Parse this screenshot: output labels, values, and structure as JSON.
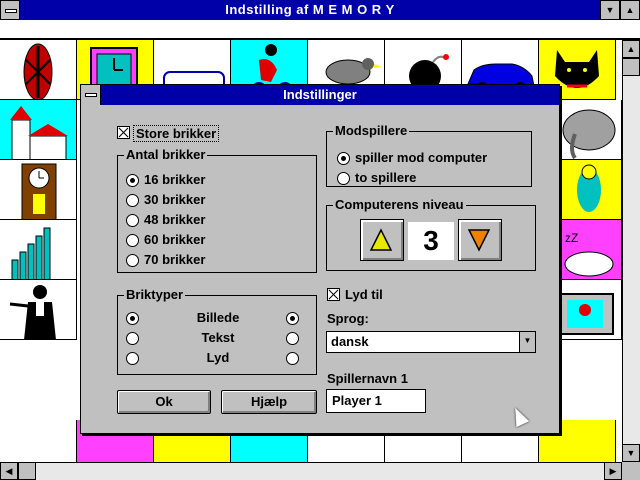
{
  "window": {
    "title": "Indstilling af M E M O R Y",
    "minimize_icon": "triangle-down",
    "maximize_icon": "triangle-up"
  },
  "dialog": {
    "title": "Indstillinger",
    "store_brikker": {
      "label": "Store brikker",
      "checked": true
    },
    "antal_brikker": {
      "label": "Antal brikker",
      "options": [
        "16 brikker",
        "30 brikker",
        "48 brikker",
        "60 brikker",
        "70 brikker"
      ],
      "selected_index": 0
    },
    "briktyper": {
      "label": "Briktyper",
      "rows": [
        "Billede",
        "Tekst",
        "Lyd"
      ],
      "left_selected_index": 0,
      "right_selected_index": 0
    },
    "ok_label": "Ok",
    "help_label": "Hjælp",
    "modspillere": {
      "label": "Modspillere",
      "options": [
        "spiller mod computer",
        "to spillere"
      ],
      "selected_index": 0
    },
    "computerens_niveau": {
      "label": "Computerens niveau",
      "value": "3",
      "up_icon": "triangle-up",
      "down_icon": "triangle-down"
    },
    "lyd_til": {
      "label": "Lyd til",
      "checked": true
    },
    "sprog": {
      "label": "Sprog:",
      "value": "dansk"
    },
    "spillernavn": {
      "label": "Spillernavn 1",
      "value": "Player 1"
    }
  },
  "board": {
    "icons": [
      "masai-shield",
      "clock",
      "car",
      "cyclist",
      "bird",
      "bomb",
      "car",
      "cat",
      "church",
      "elephant",
      "grandfather-clock",
      "parrot",
      "towers",
      "sleeping-cat",
      "conductor",
      "television"
    ]
  },
  "colors": {
    "titlebar": "#0000a8",
    "dialog_bg": "#c0c0c0",
    "arrow_up_fill": "#e8e800",
    "arrow_down_fill": "#f08000"
  }
}
